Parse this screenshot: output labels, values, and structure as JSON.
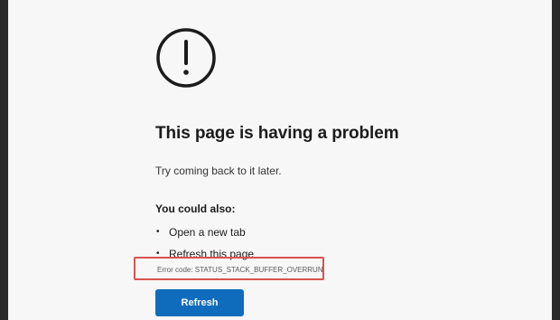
{
  "page": {
    "title": "This page is having a problem",
    "subtitle": "Try coming back to it later.",
    "also_heading": "You could also:",
    "suggestions": [
      {
        "label": "Open a new tab"
      },
      {
        "label": "Refresh this page"
      }
    ],
    "error_code": "Error code: STATUS_STACK_BUFFER_OVERRUN",
    "refresh_label": "Refresh"
  },
  "icons": {
    "alert": "exclamation-circle-icon"
  },
  "colors": {
    "button": "#0f6cbd",
    "highlight": "#d9534f",
    "background": "#f7f7f7"
  }
}
